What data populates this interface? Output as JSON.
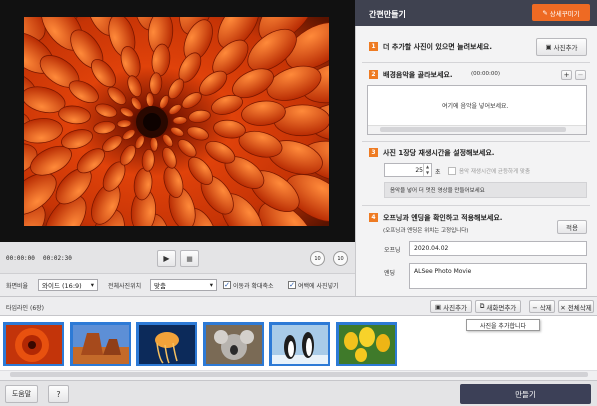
{
  "player": {
    "time_current": "00:00:00",
    "time_total": "00:02:30",
    "play_icon": "▶",
    "stop_icon": "■",
    "rewind_label": "10",
    "forward_label": "10"
  },
  "options": {
    "ratio_label": "화면비율",
    "ratio_value": "와이드 (16:9)",
    "position_label": "전체사진위치",
    "position_value": "맞춤",
    "move_zoom_label": "이동과 확대축소",
    "margin_photo_label": "여백에 사진넣기"
  },
  "panel": {
    "title": "간편만들기",
    "detail_button": "상세꾸미기",
    "step1": {
      "num": "1",
      "text": "더 추가할 사진이 있으면 늘려보세요.",
      "add_photo_button": "사진추가"
    },
    "step2": {
      "num": "2",
      "text": "배경음악을 골라보세요.",
      "duration": "(00:00:00)",
      "plus": "+",
      "minus": "−",
      "empty_text": "여기에 음악을 넣어보세요."
    },
    "step3": {
      "num": "3",
      "text": "사진 1장당 재생시간을 설정해보세요.",
      "seconds_value": "25",
      "seconds_unit": "초",
      "fit_music_label": "음악 재생시간에 균등하게 맞춤",
      "hint": "음악을 넣어 더 멋진 영상을 만들어보세요"
    },
    "step4": {
      "num": "4",
      "text": "오프닝과 엔딩을 확인하고 적용해보세요.",
      "subtext": "(오프닝과 엔딩은 위치는 고정입니다)",
      "apply_button": "적용",
      "opening_label": "오프닝",
      "opening_value": "2020.04.02",
      "ending_label": "엔딩",
      "ending_value": "ALSee Photo Movie"
    }
  },
  "timeline": {
    "title": "타임라인 (6장)",
    "add_photo": "사진추가",
    "add_screen": "새화면추가",
    "delete": "− 삭제",
    "delete_all": "✕ 전체삭제",
    "tooltip": "사진을 추가합니다",
    "thumbs": [
      "dahlia",
      "desert",
      "jellyfish",
      "koala",
      "penguins",
      "tulips"
    ]
  },
  "footer": {
    "help": "도움말",
    "question": "?",
    "make": "만들기"
  },
  "colors": {
    "accent": "#ee7b23",
    "selection": "#2d7ad6",
    "header": "#3f4250",
    "make_button": "#3c4057"
  }
}
